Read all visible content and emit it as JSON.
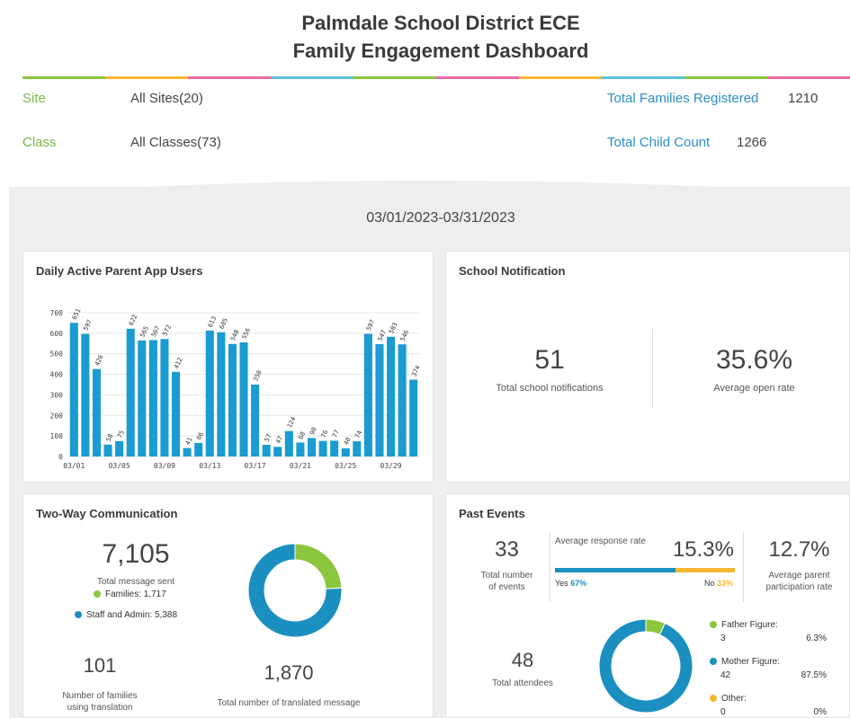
{
  "header": {
    "title_line1": "Palmdale School District ECE",
    "title_line2": "Family Engagement Dashboard",
    "site_label": "Site",
    "site_value": "All Sites(20)",
    "class_label": "Class",
    "class_value": "All Classes(73)",
    "families_label": "Total Families Registered",
    "families_value": "1210",
    "child_label": "Total Child Count",
    "child_value": "1266",
    "label_color": "#7ab648",
    "stat_color": "#2a8fc4",
    "stripe_colors": [
      "#8cc63f",
      "#f7b733",
      "#e86aa5",
      "#5bc0de",
      "#8cc63f",
      "#e86aa5",
      "#f7b733",
      "#5bc0de",
      "#8cc63f",
      "#e86aa5"
    ]
  },
  "date_range": "03/01/2023-03/31/2023",
  "dau": {
    "title": "Daily Active Parent App Users"
  },
  "chart_data": {
    "type": "bar",
    "title": "Daily Active Parent App Users",
    "bar_color": "#1a9bd1",
    "ylim": [
      0,
      700
    ],
    "y_ticks": [
      "0",
      "100",
      "200",
      "300",
      "400",
      "500",
      "600",
      "700"
    ],
    "x_tick_labels": [
      "03/01",
      "03/05",
      "03/09",
      "03/13",
      "03/17",
      "03/21",
      "03/25",
      "03/29"
    ],
    "x_tick_day_index": [
      0,
      4,
      8,
      12,
      16,
      20,
      24,
      28
    ],
    "grid": true,
    "values": [
      651,
      597,
      426,
      58,
      75,
      622,
      565,
      567,
      572,
      412,
      41,
      66,
      613,
      605,
      548,
      556,
      350,
      57,
      47,
      124,
      68,
      90,
      76,
      77,
      40,
      74,
      597,
      547,
      583,
      546,
      374
    ],
    "labels": [
      "651",
      "597",
      "426",
      "58",
      "75",
      "622",
      "565",
      "567",
      "572",
      "412",
      "41",
      "66",
      "613",
      "605",
      "548",
      "556",
      "350",
      "57",
      "47",
      "124",
      "68",
      "90",
      "76",
      "77",
      "40",
      "74",
      "597",
      "547",
      "583",
      "546",
      "374"
    ]
  },
  "notification": {
    "title": "School Notification",
    "total_value": "51",
    "total_label": "Total school notifications",
    "rate_value": "35.6%",
    "rate_label": "Average open rate"
  },
  "communication": {
    "title": "Two-Way Communication",
    "total_value": "7,105",
    "total_label": "Total message sent",
    "families_label": "Families: 1,717",
    "staff_label": "Staff and Admin: 5,388",
    "families_color": "#8cc63f",
    "staff_color": "#1a8fc0",
    "families_count": 1717,
    "staff_count": 5388,
    "translation_value": "101",
    "translation_label_line1": "Number of families",
    "translation_label_line2": "using translation",
    "translated_value": "1,870",
    "translated_label": "Total number of translated message"
  },
  "events": {
    "title": "Past Events",
    "count_value": "33",
    "count_label_line1": "Total number",
    "count_label_line2": "of events",
    "response_label": "Average response rate",
    "response_value": "15.3%",
    "yes_label": "Yes",
    "yes_pct": "67%",
    "no_label": "No",
    "no_pct": "33%",
    "yes_fraction": 0.67,
    "yes_color": "#1a8fc0",
    "no_color": "#f7b733",
    "participation_value": "12.7%",
    "participation_label_line1": "Average parent",
    "participation_label_line2": "participation rate",
    "attendees_value": "48",
    "attendees_label": "Total attendees",
    "breakdown": [
      {
        "label": "Father Figure:",
        "count": "3",
        "pct": "6.3%",
        "fraction": 0.063,
        "color": "#8cc63f"
      },
      {
        "label": "Mother Figure:",
        "count": "42",
        "pct": "87.5%",
        "fraction": 0.875,
        "color": "#1a8fc0"
      },
      {
        "label": "Other:",
        "count": "0",
        "pct": "0%",
        "fraction": 0.0,
        "color": "#f7b733"
      }
    ]
  }
}
